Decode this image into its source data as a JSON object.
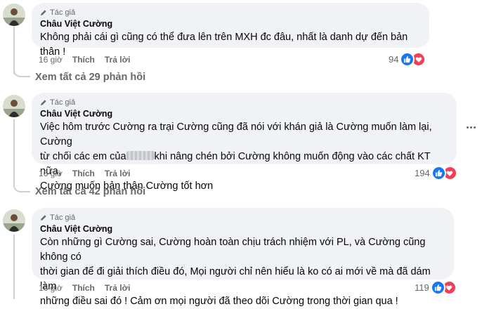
{
  "comments": [
    {
      "author_tag": "Tác giả",
      "author_name": "Châu Việt Cường",
      "text": "Không phải cái gì cũng có thể đưa lên trên MXH đc đâu, nhất là danh dự đến bản thân !",
      "time": "16 giờ",
      "like_label": "Thích",
      "reply_label": "Trả lời",
      "reaction_count": "94",
      "view_replies": "Xem tất cả 29 phản hồi"
    },
    {
      "author_tag": "Tác giả",
      "author_name": "Châu Việt Cường",
      "text_line1": "Việc hôm trước Cường ra trại Cường cũng đã nói với khán giả là Cường muốn làm lại, Cường",
      "text_line2_a": "từ chối các em của",
      "text_line2_b": "khi nâng chén bởi Cường không muốn động vào các chất KT nữa,",
      "text_line3": "Cường muốn bản thân Cường tốt hơn",
      "time": "16 giờ",
      "like_label": "Thích",
      "reply_label": "Trả lời",
      "reaction_count": "194",
      "view_replies": "Xem tất cả 42 phản hồi"
    },
    {
      "author_tag": "Tác giả",
      "author_name": "Châu Việt Cường",
      "text_line1": "Còn những gì Cường sai, Cường hoàn toàn chịu trách nhiệm với PL, và Cường cũng không có",
      "text_line2": "thời gian để đi giải thích điều đó, Mọi người chỉ nên hiểu là ko có ai mới về mà đã dám làm",
      "text_line3": "những điều sai đó ! Cảm ơn mọi người đã theo dõi Cường trong thời gian qua !",
      "time": "16 giờ",
      "like_label": "Thích",
      "reply_label": "Trả lời",
      "reaction_count": "119"
    }
  ],
  "icons": {
    "author_tag": "pencil-icon",
    "like": "like-icon",
    "love": "heart-icon",
    "more": "more-options-icon"
  },
  "colors": {
    "bubble": "#f0f2f5",
    "like": "#1877f2",
    "love": "#f33e58",
    "secondary_text": "#65676b"
  }
}
